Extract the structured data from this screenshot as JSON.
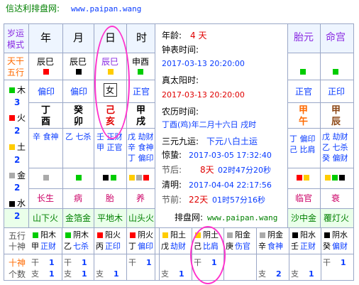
{
  "header": {
    "title": "信达利排盘网:",
    "url": "www.paipan.wang"
  },
  "left_labels": {
    "row1": [
      "岁运",
      "模式"
    ],
    "row2": [
      "天干",
      "五行"
    ]
  },
  "wuxing_legend": [
    {
      "name": "木",
      "count": "3",
      "color": "#00cc00"
    },
    {
      "name": "火",
      "count": "2",
      "color": "#ff0000"
    },
    {
      "name": "土",
      "count": "2",
      "color": "#ffcc00"
    },
    {
      "name": "金",
      "count": "2",
      "color": "#aaaaaa"
    },
    {
      "name": "水",
      "count": "2",
      "color": "#000000"
    }
  ],
  "pillars": {
    "headers": [
      "年",
      "月",
      "日",
      "时"
    ],
    "tiangan_wuxing": [
      "辰巳",
      "辰巳",
      "辰巳",
      "申酉"
    ],
    "stem_gods": [
      "偏印",
      "偏印",
      "女",
      "正官"
    ],
    "ganzhi": [
      {
        "gan": "丁",
        "zhi": "酉"
      },
      {
        "gan": "癸",
        "zhi": "卯"
      },
      {
        "gan": "己",
        "zhi": "亥"
      },
      {
        "gan": "甲",
        "zhi": "戌"
      }
    ],
    "hidden": [
      [
        "辛 食神"
      ],
      [
        "乙 七杀"
      ],
      [
        "壬 正财",
        "甲 正官"
      ],
      [
        "戊 劫财",
        "辛 食神",
        "丁 偏印"
      ]
    ],
    "changsheng": [
      "长生",
      "病",
      "胎",
      "养"
    ],
    "nayin": [
      "山下火",
      "金箔金",
      "平地木",
      "山头火"
    ]
  },
  "info": {
    "age_label": "年龄:",
    "age_value": "4 天",
    "clock_label": "钟表时间:",
    "clock_value": "2017-03-13 20:20:00",
    "solar_label": "真太阳时:",
    "solar_value": "2017-03-13 20:20:00",
    "lunar_label": "农历时间:",
    "lunar_value": "丁酉(鸡)年二月十六日 戌时",
    "yun_label": "三元九运:",
    "yun_value": "下元八白土运",
    "jingzhe_label": "惊蛰:",
    "jingzhe_value": "2017-03-05 17:32:40",
    "jieqi_before_label": "节后:",
    "jieqi_before_days": "8天",
    "jieqi_before_time": "02时47分20秒",
    "qingming_label": "清明:",
    "qingming_value": "2017-04-04 22:17:56",
    "jieqi_after_label": "节前:",
    "jieqi_after_days": "22天",
    "jieqi_after_time": "01时57分16秒",
    "site_label": "排盘网:",
    "site_value": "www.paipan.wang"
  },
  "right_panel": {
    "headers": [
      "胎元",
      "命宫"
    ],
    "gods": [
      "正官",
      "正印"
    ],
    "ganzhi": [
      {
        "gan": "甲",
        "zhi": "午"
      },
      {
        "gan": "甲",
        "zhi": "辰"
      }
    ],
    "hidden": [
      [
        "丁 偏印",
        "己 比肩"
      ],
      [
        "戊 劫财",
        "乙 七杀",
        "癸 偏财"
      ]
    ],
    "changsheng": [
      "临官",
      "衰"
    ],
    "nayin": [
      "沙中金",
      "覆灯火"
    ]
  },
  "bottom": {
    "row_labels": [
      "五行",
      "十神"
    ],
    "count_labels": [
      "十神",
      "个数"
    ],
    "cells": [
      {
        "yy": "阳木",
        "god": "正财",
        "gan": "甲"
      },
      {
        "yy": "阴木",
        "god": "七杀",
        "gan": "乙"
      },
      {
        "yy": "阳火",
        "god": "正印",
        "gan": "丙"
      },
      {
        "yy": "阴火",
        "god": "偏印",
        "gan": "丁"
      },
      {
        "yy": "阳土",
        "god": "劫财",
        "gan": "戊"
      },
      {
        "yy": "阴土",
        "god": "比肩",
        "gan": "己"
      },
      {
        "yy": "阳金",
        "god": "伤官",
        "gan": "庚"
      },
      {
        "yy": "阴金",
        "god": "食神",
        "gan": "辛"
      },
      {
        "yy": "阳水",
        "god": "正财",
        "gan": "壬"
      },
      {
        "yy": "阴水",
        "god": "偏财",
        "gan": "癸"
      }
    ],
    "counts": [
      {
        "gan": "1",
        "zhi": "1"
      },
      {
        "gan": "1",
        "zhi": "1"
      },
      {
        "gan": "",
        "zhi": "1"
      },
      {
        "gan": "1",
        "zhi": ""
      },
      {
        "gan": "",
        "zhi": "1"
      },
      {
        "gan": "1",
        "zhi": ""
      },
      {
        "gan": "",
        "zhi": ""
      },
      {
        "gan": "",
        "zhi": "2"
      },
      {
        "gan": "",
        "zhi": "1"
      },
      {
        "gan": "1",
        "zhi": ""
      }
    ],
    "gan_label": "干",
    "zhi_label": "支"
  },
  "colors": {
    "highlight": "#ff33cc",
    "border": "#9aa7c7",
    "header_bg": "#eef5ff"
  }
}
